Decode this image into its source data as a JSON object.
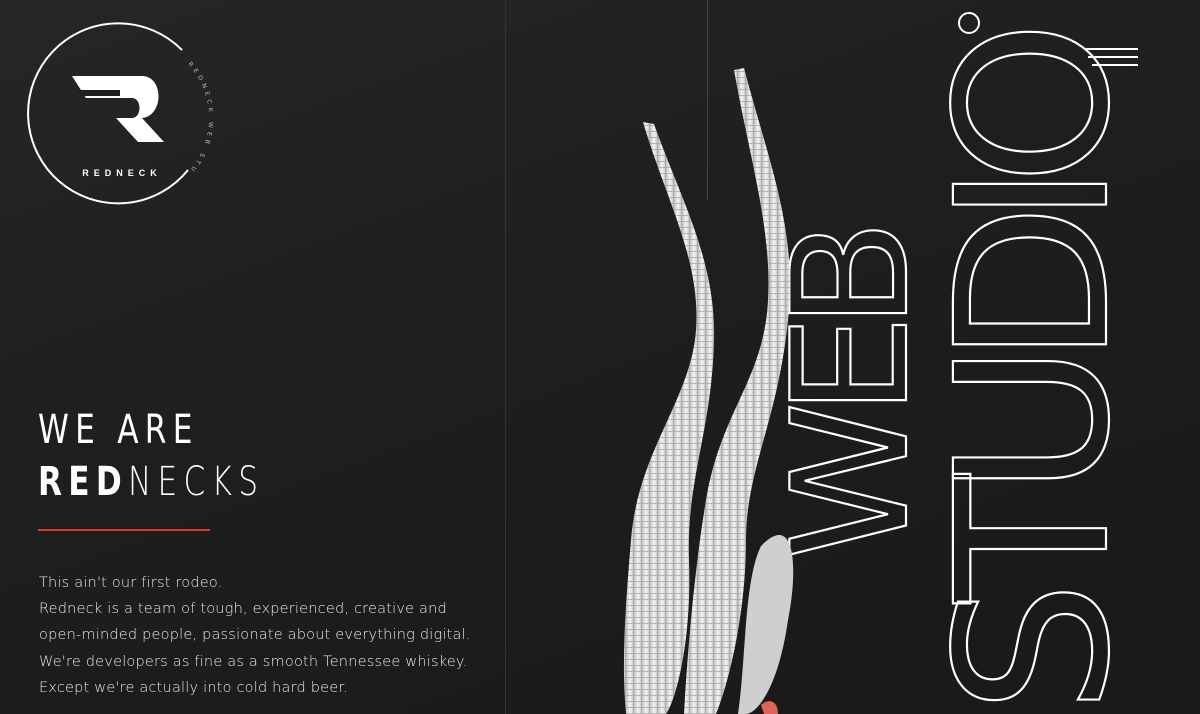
{
  "logo": {
    "brand": "REDNECK",
    "ring_text": "REDNECK WEB STUDIO",
    "glyph": "R"
  },
  "nav": {
    "menu_icon": "hamburger-menu-icon",
    "dot_icon": "circle-outline-icon"
  },
  "hero": {
    "line1": "WE ARE",
    "line2_bold": "RED",
    "line2_rest": "NECKS",
    "accent_color": "#d63a2b",
    "paragraph": [
      "This ain't our first rodeo.",
      "Redneck is a team of tough, experienced, creative and",
      "open-minded people, passionate about everything digital.",
      "We're developers as fine as a smooth Tennessee whiskey.",
      "Except we're actually into cold hard beer."
    ]
  },
  "art": {
    "word_web": "WEB",
    "word_studio": "STUDIO",
    "sculpture": "white-horns-sculpture"
  }
}
